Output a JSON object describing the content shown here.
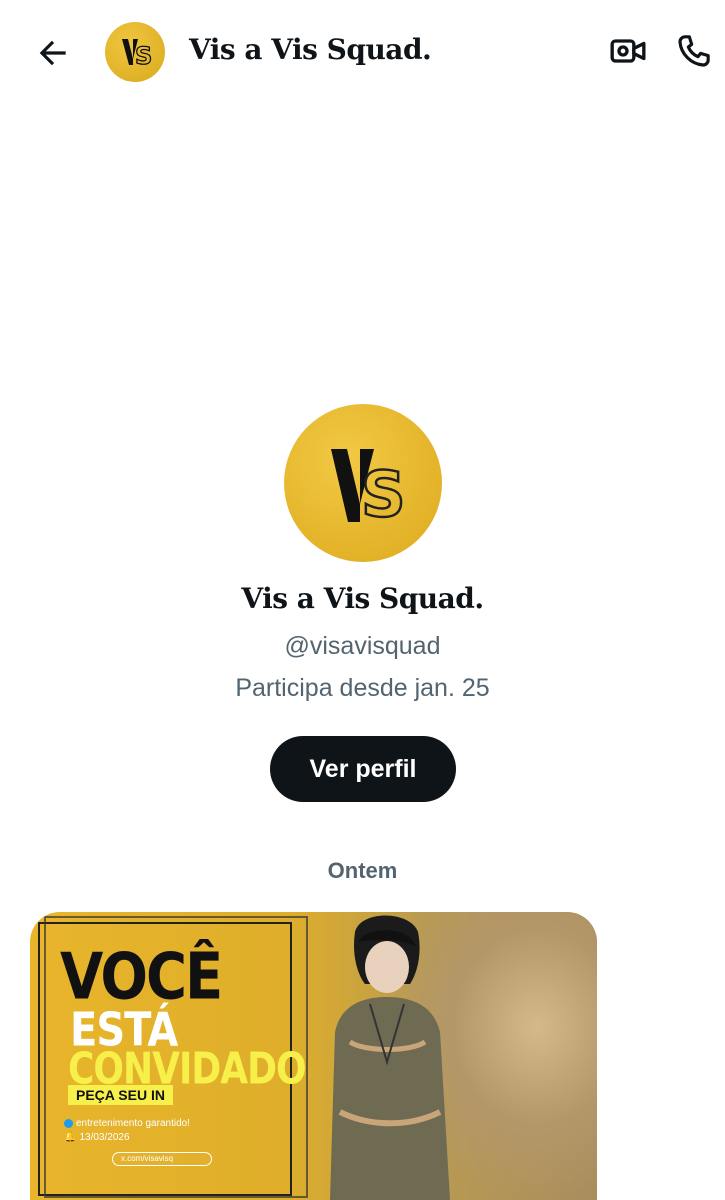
{
  "header": {
    "back_icon": "arrow-left-icon",
    "title": "Vis a Vis Squad.",
    "video_icon": "video-camera-icon",
    "call_icon": "phone-icon"
  },
  "logo": {
    "text_v": "V",
    "text_s": "S",
    "color": "#e2b22c"
  },
  "profile": {
    "name": "Vis a Vis Squad.",
    "handle": "@visavisquad",
    "joined": "Participa desde jan. 25",
    "view_profile_button": "Ver perfil"
  },
  "conversation": {
    "date_separator": "Ontem",
    "media": {
      "line1": "VOCÊ",
      "line2": "ESTÁ",
      "line3": "CONVIDADO",
      "badge": "PEÇA SEU IN",
      "note1": "entretenimento garantido!",
      "note2": "13/03/2026",
      "search_text": "x.com/visavisq"
    }
  }
}
